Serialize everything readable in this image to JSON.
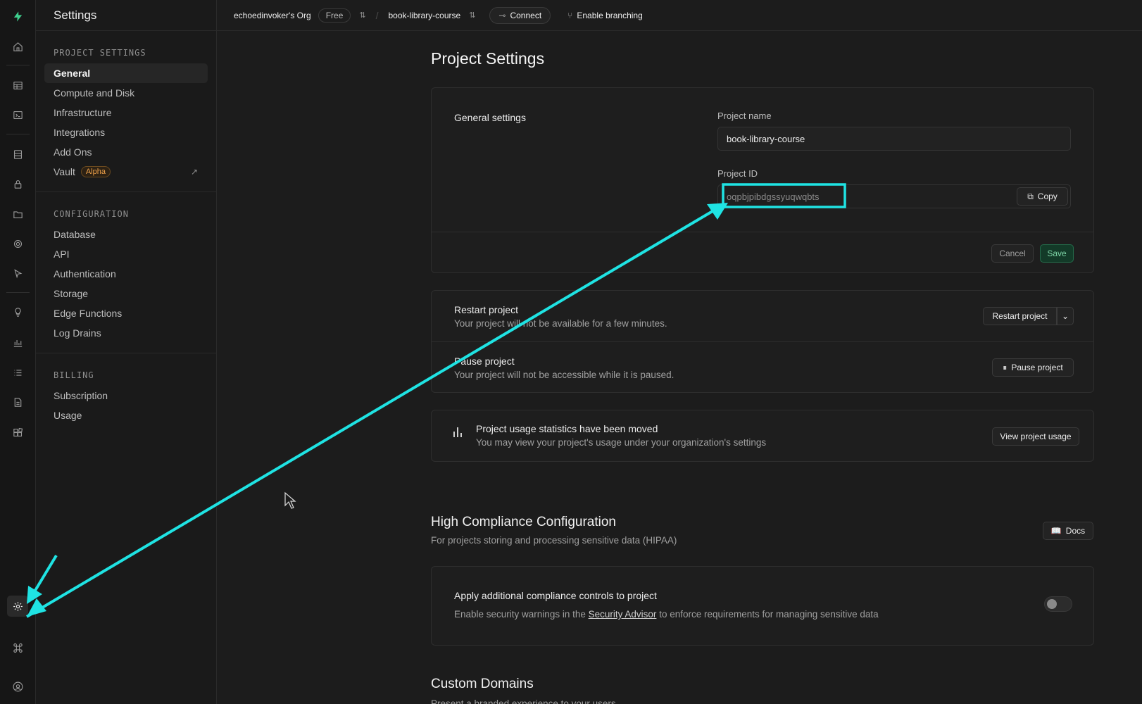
{
  "rail": {
    "icons": [
      "logo-icon",
      "home-icon",
      "table-editor-icon",
      "sql-editor-icon",
      "database-icon",
      "auth-lock-icon",
      "storage-icon",
      "realtime-icon",
      "edge-functions-icon",
      "advisors-bulb-icon",
      "reports-chart-icon",
      "logs-list-icon",
      "api-docs-icon",
      "integrations-icon",
      "settings-gear-icon",
      "command-icon",
      "account-icon"
    ]
  },
  "sidebar": {
    "title": "Settings",
    "sections": [
      {
        "title": "PROJECT SETTINGS",
        "items": [
          {
            "label": "General",
            "active": true
          },
          {
            "label": "Compute and Disk"
          },
          {
            "label": "Infrastructure"
          },
          {
            "label": "Integrations"
          },
          {
            "label": "Add Ons"
          },
          {
            "label": "Vault",
            "badge": "Alpha",
            "external": true
          }
        ]
      },
      {
        "title": "CONFIGURATION",
        "items": [
          {
            "label": "Database"
          },
          {
            "label": "API"
          },
          {
            "label": "Authentication"
          },
          {
            "label": "Storage"
          },
          {
            "label": "Edge Functions"
          },
          {
            "label": "Log Drains"
          }
        ]
      },
      {
        "title": "BILLING",
        "items": [
          {
            "label": "Subscription"
          },
          {
            "label": "Usage"
          }
        ]
      }
    ]
  },
  "topbar": {
    "org": "echoedinvoker's Org",
    "plan": "Free",
    "project": "book-library-course",
    "connect": "Connect",
    "branching": "Enable branching"
  },
  "main": {
    "title": "Project Settings",
    "general": {
      "section_label": "General settings",
      "project_name_label": "Project name",
      "project_name_value": "book-library-course",
      "project_id_label": "Project ID",
      "project_id_value": "oqpbjpibdgssyuqwqbts",
      "copy_label": "Copy",
      "cancel_label": "Cancel",
      "save_label": "Save"
    },
    "restart": {
      "title": "Restart project",
      "sub": "Your project will not be available for a few minutes.",
      "button": "Restart project"
    },
    "pause": {
      "title": "Pause project",
      "sub": "Your project will not be accessible while it is paused.",
      "button": "Pause project"
    },
    "usage": {
      "title": "Project usage statistics have been moved",
      "sub": "You may view your project's usage under your organization's settings",
      "button": "View project usage"
    },
    "compliance": {
      "title": "High Compliance Configuration",
      "sub": "For projects storing and processing sensitive data (HIPAA)",
      "docs": "Docs",
      "card_title": "Apply additional compliance controls to project",
      "card_sub_pre": "Enable security warnings in the",
      "card_sub_link": "Security Advisor",
      "card_sub_post": "to enforce requirements for managing sensitive data",
      "toggle_on": false
    },
    "custom_domains": {
      "title": "Custom Domains",
      "sub": "Present a branded experience to your users"
    }
  },
  "annotation": {
    "color": "#1fe3e3"
  }
}
